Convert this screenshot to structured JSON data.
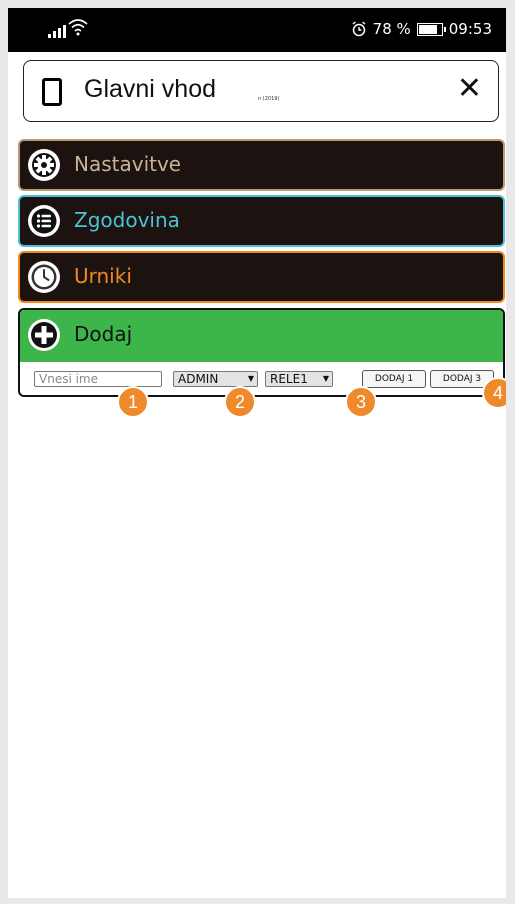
{
  "status_bar": {
    "alarm_icon": "alarm-clock-icon",
    "battery_percent": "78 %",
    "time": "09:53"
  },
  "header": {
    "title": "Glavni vhod",
    "close_label": "✕"
  },
  "menu": [
    {
      "label": "Nastavitve",
      "icon": "gear-icon",
      "color": "#b99a74"
    },
    {
      "label": "Zgodovina",
      "icon": "list-icon",
      "color": "#4fc1d5"
    },
    {
      "label": "Urniki",
      "icon": "clock-icon",
      "color": "#f08a1e"
    }
  ],
  "add_panel": {
    "label": "Dodaj",
    "color": "#3cb54a",
    "name_input": {
      "placeholder": "Vnesi ime",
      "value": ""
    },
    "role_select": {
      "value": "ADMIN"
    },
    "relay_select": {
      "value": "RELE1"
    },
    "button1": "DODAJ 1",
    "button3": "DODAJ 3",
    "footnote": "n (2019)"
  },
  "callouts": [
    "1",
    "2",
    "3",
    "4"
  ]
}
